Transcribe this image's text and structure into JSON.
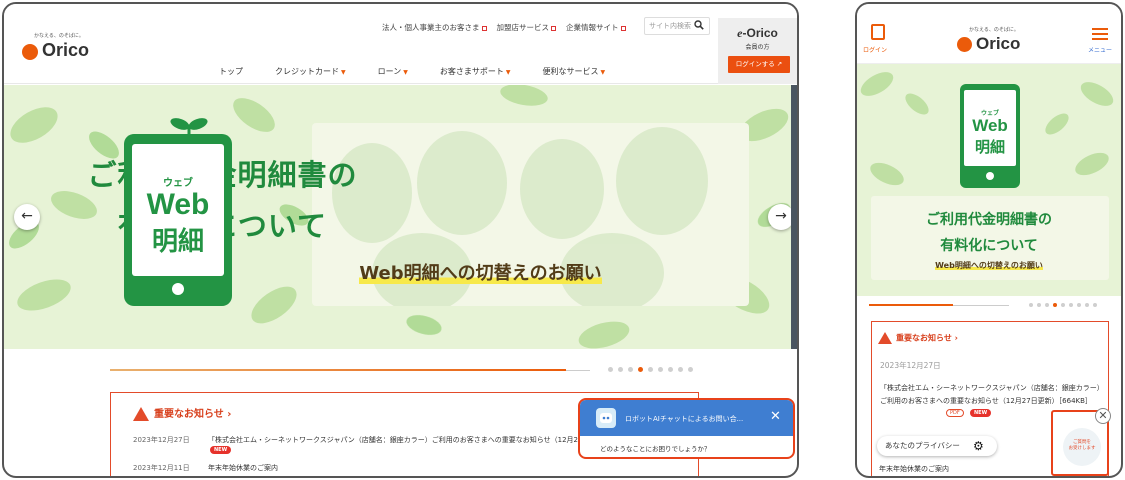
{
  "desktop": {
    "logo": {
      "tagline": "かなえる、のそばに。",
      "name": "Orico"
    },
    "util_links": [
      "法人・個人事業主のお客さま",
      "加盟店サービス",
      "企業情報サイト"
    ],
    "search": {
      "placeholder": "サイト内検索"
    },
    "nav": [
      {
        "label": "トップ",
        "caret": false
      },
      {
        "label": "クレジットカード",
        "caret": true
      },
      {
        "label": "ローン",
        "caret": true
      },
      {
        "label": "お客さまサポート",
        "caret": true
      },
      {
        "label": "便利なサービス",
        "caret": true
      }
    ],
    "member": {
      "brand_e": "e",
      "brand_rest": "-Orico",
      "label": "会員の方",
      "login_button": "ログインする"
    },
    "hero": {
      "phone_kana": "ウェブ",
      "phone_web": "Web",
      "phone_meisai": "明細",
      "title_line1": "ご利用代金明細書の",
      "title_line2": "有料化について",
      "subtitle": "Web明細への切替えのお願い",
      "prev_arrow": "←",
      "next_arrow": "→"
    },
    "slider": {
      "progress": 0.95,
      "dot_count": 9,
      "active_dot": 3
    },
    "notice": {
      "heading": "重要なお知らせ ›",
      "items": [
        {
          "date": "2023年12月27日",
          "text": "「株式会社エム・シーネットワークスジャパン（店舗名：銀座カラー）ご利用のお客さまへの重要なお知らせ（12月27日更新）",
          "badge": "NEW"
        },
        {
          "date": "2023年12月11日",
          "text": "年末年始休業のご案内"
        }
      ]
    },
    "chat": {
      "title": "ロボットAIチャットによるお問い合...",
      "close": "✕",
      "message": "どのようなことにお困りでしょうか？"
    }
  },
  "mobile": {
    "login_label": "ログイン",
    "menu_label": "メニュー",
    "logo": {
      "tagline": "かなえる、のそばに。",
      "name": "Orico"
    },
    "hero": {
      "phone_kana": "ウェブ",
      "phone_web": "Web",
      "phone_meisai": "明細",
      "title_line1": "ご利用代金明細書の",
      "title_line2": "有料化について",
      "subtitle": "Web明細への切替えのお願い"
    },
    "slider": {
      "progress": 0.6,
      "dot_count": 9,
      "active_dot": 3
    },
    "notice": {
      "heading": "重要なお知らせ ›",
      "date": "2023年12月27日",
      "text": "「株式会社エム・シーネットワークスジャパン（店舗名：銀座カラー）ご利用のお客さまへの重要なお知らせ（12月27日更新）［664KB］",
      "pdf_badge": "PDF",
      "new_badge": "NEW"
    },
    "privacy_button": "あなたのプライバシー",
    "year_end": "年末年始休業のご案内",
    "chat": {
      "text": "ご質問を\nお受けします",
      "close": "✕"
    }
  },
  "colors": {
    "brand_orange": "#eb5b0a",
    "hero_green": "#208a3d",
    "hero_bg": "#e7f3d6",
    "notice_red": "#e34b2a",
    "chat_blue": "#3f7ed1"
  },
  "icons": [
    "search-icon",
    "external-link-icon",
    "arrow-left-icon",
    "arrow-right-icon",
    "warning-icon",
    "close-icon",
    "robot-avatar-icon",
    "login-door-icon",
    "hamburger-menu-icon",
    "gear-icon"
  ]
}
